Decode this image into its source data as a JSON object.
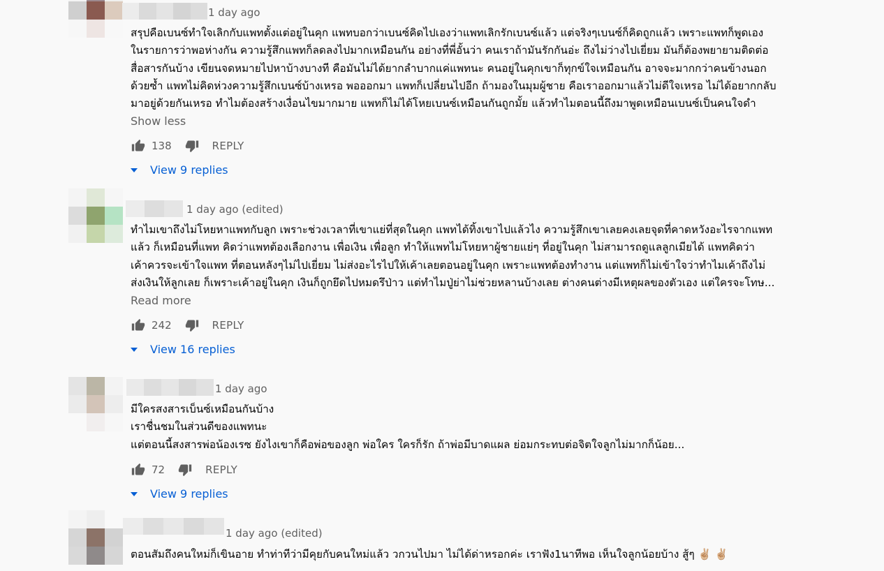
{
  "comments": [
    {
      "time": "1 day ago",
      "lines": [
        "สรุปคือเบนซ์ทำใจเลิกกับแพทตั้งแต่อยู่ในคุก แพทบอกว่าเบนซ์คิดไปเองว่าแพทเลิกรักเบนซ์แล้ว แต่จริงๆเบนซ์ก็คิดถูกแล้ว เพราะแพทก็พูดเอง",
        "ในรายการว่าพอห่างกัน ความรู้สึกแพทก็ลดลงไปมากเหมือนกัน อย่างที่พี่อั้นว่า คนเราถ้ามันรักกันอ่ะ ถึงไม่ว่างไปเยี่ยม มันก็ต้องพยายามติดต่อ",
        "สื่อสารกันบ้าง เขียนจดหมายไปหาบ้างบางที คือมันไม่ได้ยากลำบากแค่แพทนะ คนอยู่ในคุกเขาก็ทุกข์ใจเหมือนกัน อาจจะมากกว่าคนข้างนอก",
        "ด้วยซ้ำ แพทไม่คิดห่วงความรู้สึกเบนซ์บ้างเหรอ พอออกมา แพทก็เปลี่ยนไปอีก ถ้ามองในมุมผู้ชาย คือเราออกมาแล้วไม่ดีใจเหรอ ไม่ได้อยากกลับ",
        "มาอยู่ด้วยกันเหรอ ทำไมต้องสร้างเงื่อนไขมากมาย แพทก็ไม่ได้โหยเบนซ์เหมือนกันถูกมั้ย แล้วทำไมตอนนี้ถึงมาพูดเหมือนเบนซ์เป็นคนใจดำ"
      ],
      "more": "Show less",
      "likes": "138",
      "reply": "REPLY",
      "view_replies": "View 9 replies"
    },
    {
      "time": "1 day ago (edited)",
      "lines": [
        "ทำไมเขาถึงไม่โหยหาแพทกับลูก เพราะช่วงเวลาที่เขาแย่ที่สุดในคุก แพทได้ทิ้งเขาไปแล้วไง ความรู้สึกเขาเลยคงเลยจุดที่คาดหวังอะไรจากแพท",
        "แล้ว ก็เหมือนที่แพท คิดว่าแพทต้องเลือกงาน เพื่อเงิน เพื่อลูก ทำให้แพทไม่โหยหาผู้ชายแย่ๆ ที่อยู่ในคุก ไม่สามารถดูแลลูกเมียได้ แพทคิดว่า",
        "เค้าควรจะเข้าใจแพท ที่ตอนหลังๆไม่ไปเยี่ยม ไม่ส่งอะไรไปให้เค้าเลยตอนอยู่ในคุก เพราะแพทต้องทำงาน แต่แพทก็ไม่เข้าใจว่าทำไมเค้าถึงไม่",
        "ส่งเงินให้ลูกเลย ก็เพราะเค้าอยู่ในคุก เงินก็ถูกยึดไปหมดรึป่าว แต่ทำไมปู่ย่าไม่ช่วยหลานบ้างเลย ต่างคนต่างมีเหตุผลของตัวเอง แต่ใครจะโทษ..."
      ],
      "more": "Read more",
      "likes": "242",
      "reply": "REPLY",
      "view_replies": "View 16 replies"
    },
    {
      "time": "1 day ago",
      "lines": [
        "มีใครสงสารเบ็นซ์เหมือนกันบ้าง",
        "เราชื่นชมในส่วนดีของแพทนะ",
        "แต่ตอนนี้สงสารพ่อน้องเรซ  ยังไงเขาก็คือพ่อของลูก พ่อใคร ใครก็รัก ถ้าพ่อมีบาดแผล ย่อมกระทบต่อจิตใจลูกไม่มากก็น้อย..."
      ],
      "likes": "72",
      "reply": "REPLY",
      "view_replies": "View 9 replies"
    },
    {
      "time": "1 day ago (edited)",
      "lines": [
        "ตอนสัมถึงคนใหม่ก็เขินอาย ทำท่าทีว่ามีคุยกับคนใหม่แล้ว วกวนไปมา ไม่ได้ด่าหรอกค่ะ เราฟัง1นาทีพอ เห็นใจลูกน้อยบ้าง สู้ๆ ✌🏼 ✌🏼"
      ]
    }
  ],
  "icons": {
    "like": "thumb-up-icon",
    "dislike": "thumb-down-icon",
    "expand": "triangle-down-icon"
  },
  "colors": {
    "link": "#065fd4",
    "meta": "#606060",
    "text": "#030303",
    "background": "#f9f9f9"
  }
}
